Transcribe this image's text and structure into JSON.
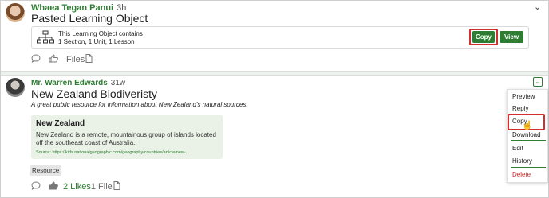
{
  "post1": {
    "author": "Whaea Tegan Panui",
    "timestamp": "3h",
    "title": "Pasted Learning Object",
    "learning_object": {
      "line1": "This Learning Object contains",
      "line2": "1 Section, 1 Unit, 1 Lesson",
      "copy_label": "Copy",
      "view_label": "View"
    },
    "actions": {
      "files_label": "Files"
    }
  },
  "post2": {
    "author": "Mr. Warren Edwards",
    "timestamp": "31w",
    "title": "New Zealand Biodiveristy",
    "subtitle": "A great public resource for information about New Zealand's natural sources.",
    "resource": {
      "title": "New Zealand",
      "description": "New Zealand is a remote, mountainous group of islands located off the southeast coast of Australia.",
      "source": "Source: https://kids.nationalgeographic.com/geography/countries/article/new-..."
    },
    "tag": "Resource",
    "actions": {
      "likes_label": "2 Likes",
      "files_label": "1 File"
    }
  },
  "menu": {
    "items": [
      "Preview",
      "Reply",
      "Copy",
      "Download",
      "Edit",
      "History",
      "Delete"
    ]
  },
  "icons": {
    "comment": "comment-icon",
    "like": "thumbs-up-icon",
    "file": "file-icon",
    "hierarchy": "hierarchy-icon",
    "chevron": "chevron-down-icon"
  },
  "colors": {
    "accent": "#2e7d32",
    "highlight": "#d32f2f",
    "card": "#eaf1e6"
  }
}
